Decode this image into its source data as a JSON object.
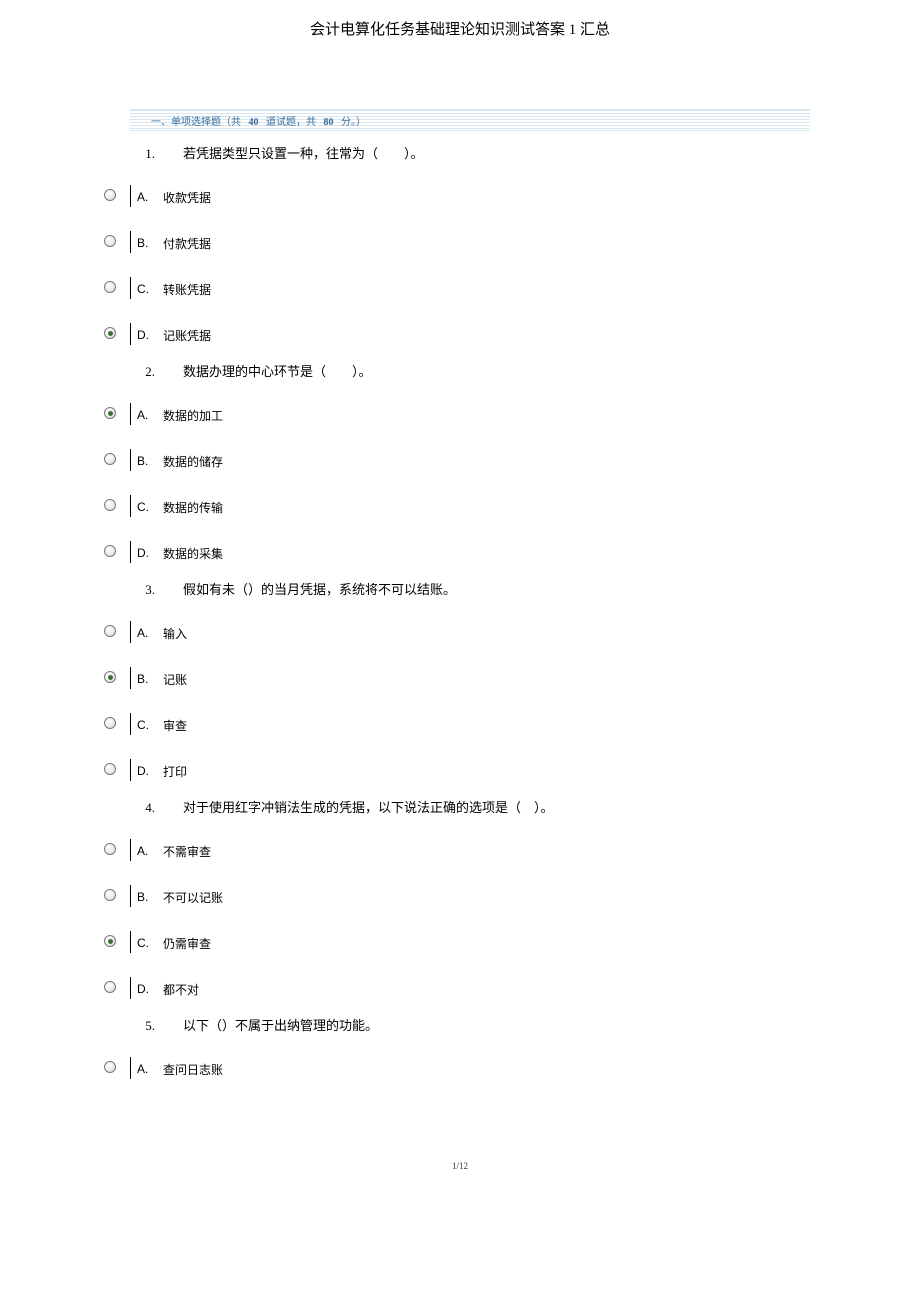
{
  "title": "会计电算化任务基础理论知识测试答案 1 汇总",
  "section": {
    "prefix": "一、单项选择题（共",
    "count1": "40",
    "mid": "道试题，共",
    "count2": "80",
    "suffix": "分。）"
  },
  "questions": [
    {
      "no": "1.",
      "text": "若凭据类型只设置一种，往常为（　　）。",
      "options": [
        {
          "label": "A.",
          "text": "收款凭据",
          "checked": false
        },
        {
          "label": "B.",
          "text": "付款凭据",
          "checked": false
        },
        {
          "label": "C.",
          "text": "转账凭据",
          "checked": false
        },
        {
          "label": "D.",
          "text": "记账凭据",
          "checked": true
        }
      ]
    },
    {
      "no": "2.",
      "text": "数据办理的中心环节是（　　）。",
      "options": [
        {
          "label": "A.",
          "text": "数据的加工",
          "checked": true
        },
        {
          "label": "B.",
          "text": "数据的储存",
          "checked": false
        },
        {
          "label": "C.",
          "text": "数据的传输",
          "checked": false
        },
        {
          "label": "D.",
          "text": "数据的采集",
          "checked": false
        }
      ]
    },
    {
      "no": "3.",
      "text": "假如有未（）的当月凭据，系统将不可以结账。",
      "options": [
        {
          "label": "A.",
          "text": "输入",
          "checked": false
        },
        {
          "label": "B.",
          "text": "记账",
          "checked": true
        },
        {
          "label": "C.",
          "text": "审查",
          "checked": false
        },
        {
          "label": "D.",
          "text": "打印",
          "checked": false
        }
      ]
    },
    {
      "no": "4.",
      "text": "对于使用红字冲销法生成的凭据，以下说法正确的选项是（　）。",
      "options": [
        {
          "label": "A.",
          "text": "不需审查",
          "checked": false
        },
        {
          "label": "B.",
          "text": "不可以记账",
          "checked": false
        },
        {
          "label": "C.",
          "text": "仍需审查",
          "checked": true
        },
        {
          "label": "D.",
          "text": "都不对",
          "checked": false
        }
      ]
    },
    {
      "no": "5.",
      "text": "以下（）不属于出纳管理的功能。",
      "options": [
        {
          "label": "A.",
          "text": "查问日志账",
          "checked": false
        }
      ]
    }
  ],
  "footer": "1/12"
}
